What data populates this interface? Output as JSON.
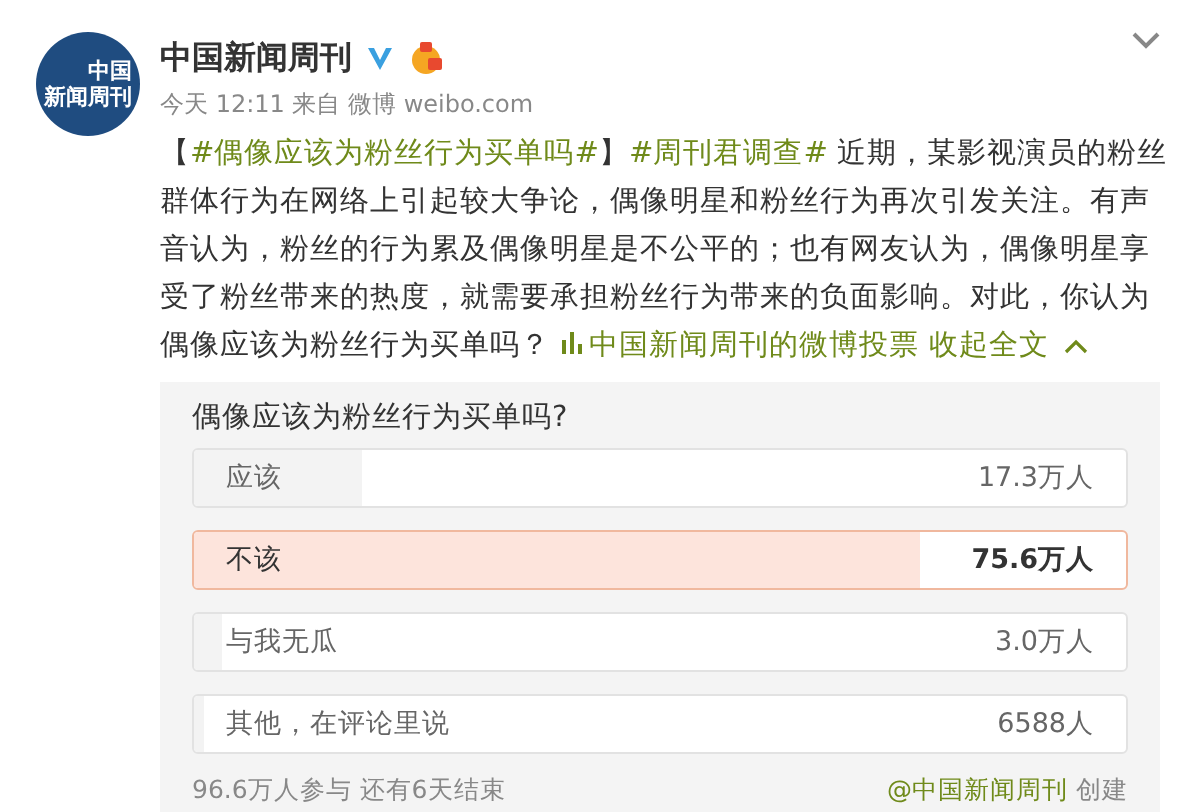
{
  "post": {
    "avatar_lines": [
      "中国",
      "新闻周刊"
    ],
    "author": "中国新闻周刊",
    "time": "今天 12:11 来自 微博 weibo.com",
    "body": [
      {
        "kind": "text",
        "text": "【"
      },
      {
        "kind": "link",
        "text": "#偶像应该为粉丝行为买单吗#"
      },
      {
        "kind": "text",
        "text": "】"
      },
      {
        "kind": "link",
        "text": "#周刊君调查#"
      },
      {
        "kind": "text",
        "text": " 近期，某影视演员的粉丝群体行为在网络上引起较大争论，偶像明星和粉丝行为再次引发关注。有声音认为，粉丝的行为累及偶像明星是不公平的；也有网友认为，偶像明星享受了粉丝带来的热度，就需要承担粉丝行为带来的负面影响。对此，你认为偶像应该为粉丝行为买单吗？ "
      }
    ],
    "vote_link": "中国新闻周刊的微博投票",
    "collapse_link": "收起全文"
  },
  "poll": {
    "title": "偶像应该为粉丝行为买单吗?",
    "options": [
      {
        "label": "应该",
        "count": "17.3万人",
        "level": 0.18,
        "selected": false
      },
      {
        "label": "不该",
        "count": "75.6万人",
        "level": 0.78,
        "selected": true
      },
      {
        "label": "与我无瓜",
        "count": "3.0万人",
        "level": 0.03,
        "selected": false
      },
      {
        "label": "其他，在评论里说",
        "count": "6588人",
        "level": 0.01,
        "selected": false
      }
    ],
    "stats": "96.6万人参与 还有6天结束",
    "creator": "@中国新闻周刊",
    "created": "创建"
  }
}
